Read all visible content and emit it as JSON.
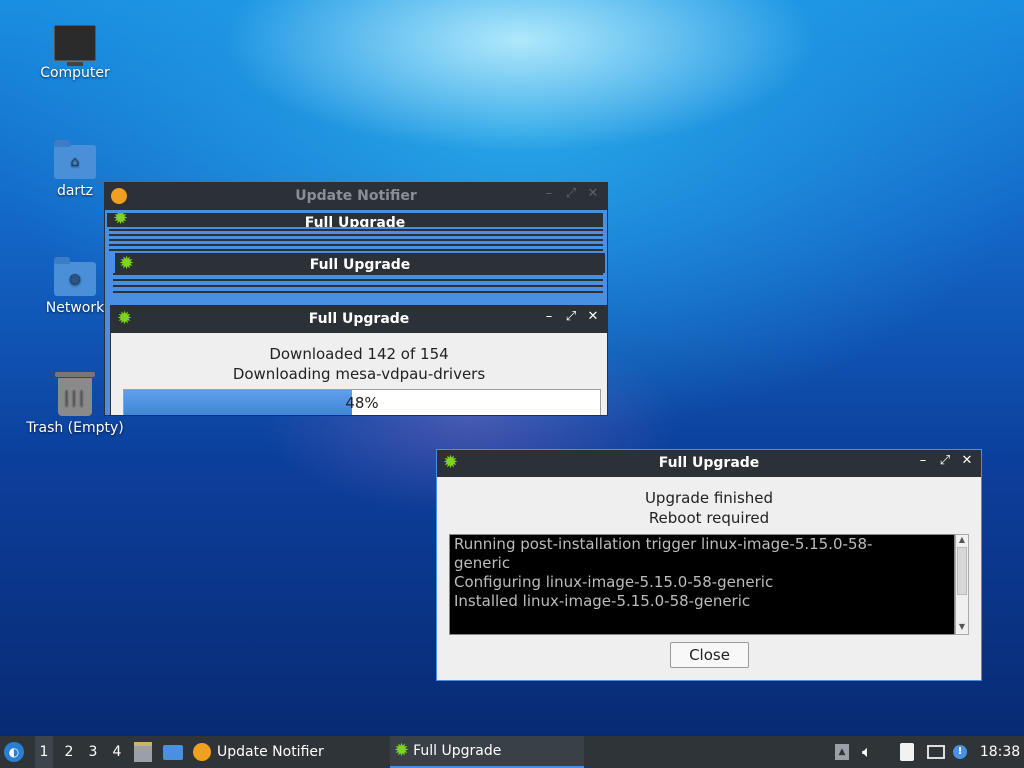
{
  "desktop": {
    "icons": [
      {
        "label": "Computer",
        "icon": "computer-icon"
      },
      {
        "label": "dartz",
        "icon": "home-folder-icon"
      },
      {
        "label": "Network",
        "icon": "network-folder-icon"
      },
      {
        "label": "Trash (Empty)",
        "icon": "trash-icon"
      }
    ]
  },
  "notifier": {
    "title": "Update Notifier"
  },
  "ghosts": [
    {
      "title": "Full Upgrade"
    },
    {
      "title": "Full Upgrade"
    }
  ],
  "progress_window": {
    "title": "Full Upgrade",
    "line1": "Downloaded 142 of 154",
    "line2": "Downloading mesa-vdpau-drivers",
    "progress_label": "48%",
    "progress": 0.48
  },
  "finished_window": {
    "title": "Full Upgrade",
    "line1": "Upgrade finished",
    "line2": "Reboot required",
    "log": [
      "Running post-installation trigger linux-image-5.15.0-58-generic",
      "Configuring linux-image-5.15.0-58-generic",
      "Installed linux-image-5.15.0-58-generic"
    ],
    "close_label": "Close"
  },
  "window_controls": {
    "minimize": "–",
    "maximize": "⤢",
    "close": "✕"
  },
  "taskbar": {
    "workspaces": [
      "1",
      "2",
      "3",
      "4"
    ],
    "tasks": [
      {
        "label": "Update Notifier"
      },
      {
        "label": "Full Upgrade"
      }
    ],
    "clock": "18:38"
  },
  "colors": {
    "accent": "#4a90e2",
    "titlebar": "#2c3138",
    "taskbar": "#2f3439"
  }
}
